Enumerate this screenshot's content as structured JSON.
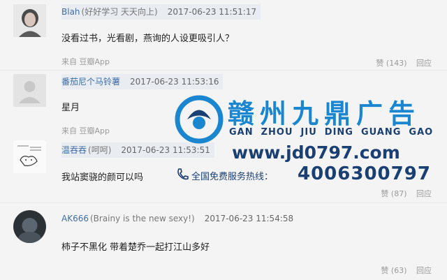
{
  "comments": [
    {
      "user": "Blah",
      "signature": "(好好学习 天天向上)",
      "time": "2017-06-23 11:51:17",
      "text": "没看过书，光看剧，燕询的人设更吸引人？",
      "from_prefix": "来自",
      "from_app": "豆瓣App",
      "like_label": "赞",
      "likes": "(143)",
      "reply_label": "回应"
    },
    {
      "user": "番茄尼个马铃薯",
      "signature": "",
      "time": "2017-06-23 11:53:16",
      "text": "星月",
      "from_prefix": "来自",
      "from_app": "豆瓣App",
      "like_label": "",
      "likes": "",
      "reply_label": ""
    },
    {
      "user": "温吞吞",
      "signature": "(呵呵)",
      "time": "2017-06-23 11:53:51",
      "text": "我站窦骁的颜可以吗",
      "from_prefix": "",
      "from_app": "",
      "like_label": "赞",
      "likes": "(87)",
      "reply_label": "回应"
    },
    {
      "user": "AK666",
      "signature": "(Brainy is the new sexy!)",
      "time": "2017-06-23 11:54:58",
      "text": "柿子不黑化 带着楚乔一起打江山多好",
      "from_prefix": "",
      "from_app": "",
      "like_label": "赞",
      "likes": "(63)",
      "reply_label": "回应"
    }
  ],
  "watermark": {
    "brand": "赣州九鼎广告",
    "pinyin": [
      "GAN",
      "ZHOU",
      "JIU",
      "DING",
      "GUANG",
      "GAO"
    ],
    "url": "www.jd0797.com",
    "hotline_label": "全国免费服务热线：",
    "phone": "4006300797",
    "brand_color": "#1a86d0",
    "text_color": "#1a3f73"
  },
  "colors": {
    "username": "#3d6ea8",
    "meta_bg": "#e9ecf0",
    "muted": "#9a9a9a"
  }
}
